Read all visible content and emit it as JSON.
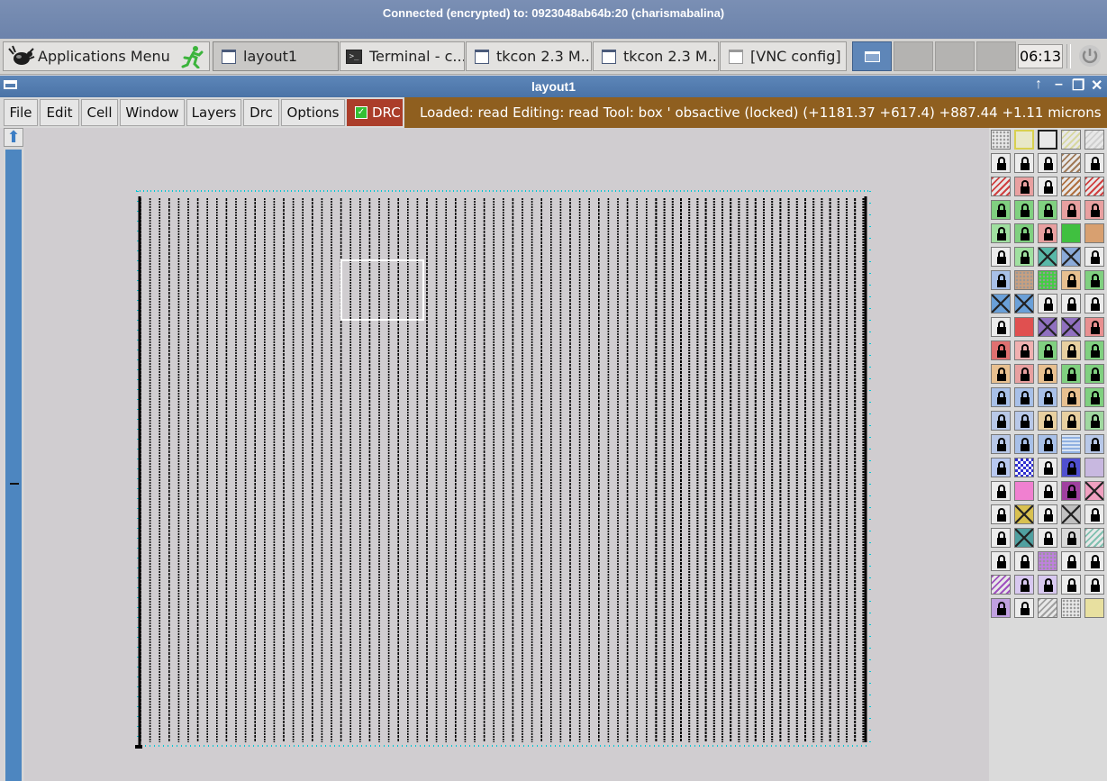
{
  "vnc": {
    "title": "Connected (encrypted) to: 0923048ab64b:20 (charismabalina)"
  },
  "taskbar": {
    "apps_menu": "Applications Menu",
    "tasks": [
      "layout1",
      "Terminal - c...",
      "tkcon 2.3 M...",
      "tkcon 2.3 M...",
      "[VNC config]"
    ],
    "clock": "06:13"
  },
  "window": {
    "title": "layout1",
    "controls": [
      "↑",
      "–",
      "❐",
      "✕"
    ]
  },
  "menu": {
    "items": [
      "File",
      "Edit",
      "Cell",
      "Window",
      "Layers",
      "Drc",
      "Options"
    ],
    "drc_label": "DRC",
    "drc_checked": true
  },
  "status": {
    "text": "Loaded: read  Editing: read  Tool: box  ' obsactive (locked)   (+1181.37 +617.4) +887.44 +1.11 microns"
  },
  "scrollbar": {
    "up_arrow": "⬆"
  },
  "colors": {
    "title_bar": "#4a73a6",
    "drc_button": "#ab3d2a",
    "status_bar": "#8f5f1f",
    "canvas": "#d0cdd0",
    "scroll_track": "#4d86c0",
    "layout_lines": "#000000",
    "layout_edge_ticks": "#00c8d6",
    "selection_box": "#ffffff"
  },
  "layer_palette": {
    "columns": 5,
    "swatches": [
      [
        "grid",
        "#e8e8e8",
        0
      ],
      [
        "yellow-outline",
        "#e8e8c8",
        0
      ],
      [
        "black-outline",
        "#e8e8e8",
        0
      ],
      [
        "yellow-diag",
        "#d8d8a0",
        0
      ],
      [
        "black-diag",
        "#d0d0d0",
        0
      ],
      [
        "lock",
        "#ececec",
        1
      ],
      [
        "lock",
        "#ececec",
        1
      ],
      [
        "lock",
        "#ececec",
        1
      ],
      [
        "brown-diag",
        "#a07a58",
        0
      ],
      [
        "lock",
        "#ececec",
        1
      ],
      [
        "red-diag",
        "#d04040",
        0
      ],
      [
        "lock-red",
        "#e8a0a0",
        1
      ],
      [
        "lock",
        "#ececec",
        1
      ],
      [
        "brown-diag",
        "#b07040",
        0
      ],
      [
        "red-diag",
        "#d04040",
        0
      ],
      [
        "lock-green",
        "#80d080",
        1
      ],
      [
        "lock-green",
        "#80d080",
        1
      ],
      [
        "lock-green",
        "#80d080",
        1
      ],
      [
        "lock-pink",
        "#e8a0a0",
        1
      ],
      [
        "lock-red",
        "#e8a0a0",
        1
      ],
      [
        "lock-green",
        "#a0e0a0",
        1
      ],
      [
        "lock-green",
        "#80d080",
        1
      ],
      [
        "lock-pink",
        "#e8a0a0",
        1
      ],
      [
        "green",
        "#40c040",
        0
      ],
      [
        "tan",
        "#d8a070",
        0
      ],
      [
        "lock",
        "#ececec",
        1
      ],
      [
        "lock-green",
        "#a0e0a0",
        1
      ],
      [
        "cyan-x",
        "#58b8a8",
        0
      ],
      [
        "blue-x",
        "#8aaad8",
        0
      ],
      [
        "lock",
        "#ececec",
        1
      ],
      [
        "lock-blue",
        "#a8c0e8",
        1
      ],
      [
        "tan-dots",
        "#c8a080",
        0
      ],
      [
        "green-dots",
        "#40d040",
        0
      ],
      [
        "lock-tan",
        "#e8c090",
        1
      ],
      [
        "lock-green",
        "#80d080",
        1
      ],
      [
        "blue-x",
        "#6aa0d8",
        0
      ],
      [
        "blue-x",
        "#6aa0d8",
        0
      ],
      [
        "lock",
        "#ececec",
        1
      ],
      [
        "lock",
        "#ececec",
        1
      ],
      [
        "lock",
        "#ececec",
        1
      ],
      [
        "lock",
        "#ececec",
        1
      ],
      [
        "red",
        "#e05050",
        0
      ],
      [
        "purple-x",
        "#9070c0",
        0
      ],
      [
        "purple-x",
        "#9070c0",
        0
      ],
      [
        "lock-red",
        "#e89090",
        1
      ],
      [
        "lock-red",
        "#e07070",
        1
      ],
      [
        "lock-pink",
        "#f0b0b0",
        1
      ],
      [
        "lock-green",
        "#80d080",
        1
      ],
      [
        "lock-tan",
        "#e8d0a0",
        1
      ],
      [
        "lock-green",
        "#80d080",
        1
      ],
      [
        "lock-tan",
        "#e8c090",
        1
      ],
      [
        "lock-pink",
        "#e8a0a0",
        1
      ],
      [
        "lock-tan",
        "#e8c090",
        1
      ],
      [
        "lock-green",
        "#80d080",
        1
      ],
      [
        "lock-green",
        "#80d080",
        1
      ],
      [
        "lock-blue",
        "#a8c0e8",
        1
      ],
      [
        "lock-blue",
        "#a8c0e8",
        1
      ],
      [
        "lock-blue",
        "#a8c0e8",
        1
      ],
      [
        "lock-tan",
        "#e8c090",
        1
      ],
      [
        "lock-green",
        "#80d080",
        1
      ],
      [
        "lock-blue",
        "#b8c8e8",
        1
      ],
      [
        "lock-blue",
        "#b8c8e8",
        1
      ],
      [
        "lock-tan",
        "#e8d0a0",
        1
      ],
      [
        "lock-tan",
        "#e8d0a0",
        1
      ],
      [
        "lock-green",
        "#a0d8a0",
        1
      ],
      [
        "lock-blue",
        "#b8c8e8",
        1
      ],
      [
        "lock-blue",
        "#a8c0e8",
        1
      ],
      [
        "lock-blue",
        "#a8c0e8",
        1
      ],
      [
        "blue-wave",
        "#90b0e0",
        0
      ],
      [
        "lock-blue",
        "#b8c8e8",
        1
      ],
      [
        "lock-blue",
        "#b8c8f0",
        1
      ],
      [
        "blue-check",
        "#3030d0",
        0
      ],
      [
        "lock",
        "#ececec",
        1
      ],
      [
        "lock-blue",
        "#5050d0",
        1
      ],
      [
        "lavender",
        "#c8b8e0",
        0
      ],
      [
        "lock",
        "#ececec",
        1
      ],
      [
        "pink",
        "#f080d0",
        0
      ],
      [
        "lock",
        "#ececec",
        1
      ],
      [
        "lock-purple",
        "#a040a0",
        1
      ],
      [
        "pink-x",
        "#f0a0c0",
        0
      ],
      [
        "lock",
        "#ececec",
        1
      ],
      [
        "yellow-x",
        "#d8c050",
        0
      ],
      [
        "lock",
        "#ececec",
        1
      ],
      [
        "gray-x",
        "#c0c0c0",
        0
      ],
      [
        "lock",
        "#ececec",
        1
      ],
      [
        "lock",
        "#ececec",
        1
      ],
      [
        "teal-x",
        "#50a0a0",
        0
      ],
      [
        "lock",
        "#ececec",
        1
      ],
      [
        "lock",
        "#d8d8d8",
        1
      ],
      [
        "teal-diag",
        "#80c0b0",
        0
      ],
      [
        "lock",
        "#ececec",
        1
      ],
      [
        "lock",
        "#ececec",
        1
      ],
      [
        "purple-dots",
        "#c080e0",
        0
      ],
      [
        "lock",
        "#ececec",
        1
      ],
      [
        "lock",
        "#ececec",
        1
      ],
      [
        "purple-diag",
        "#a050c0",
        0
      ],
      [
        "lock-lavender",
        "#d8c8f0",
        1
      ],
      [
        "lock-lavender",
        "#d8c8f0",
        1
      ],
      [
        "lock",
        "#ececec",
        1
      ],
      [
        "lock",
        "#ececec",
        1
      ],
      [
        "lock-purple",
        "#c0a0e0",
        1
      ],
      [
        "lock",
        "#ececec",
        1
      ],
      [
        "gray-diag",
        "#a0a0a0",
        0
      ],
      [
        "white-dots",
        "#e8e8e8",
        0
      ],
      [
        "yellow",
        "#e8e0a0",
        0
      ]
    ]
  }
}
